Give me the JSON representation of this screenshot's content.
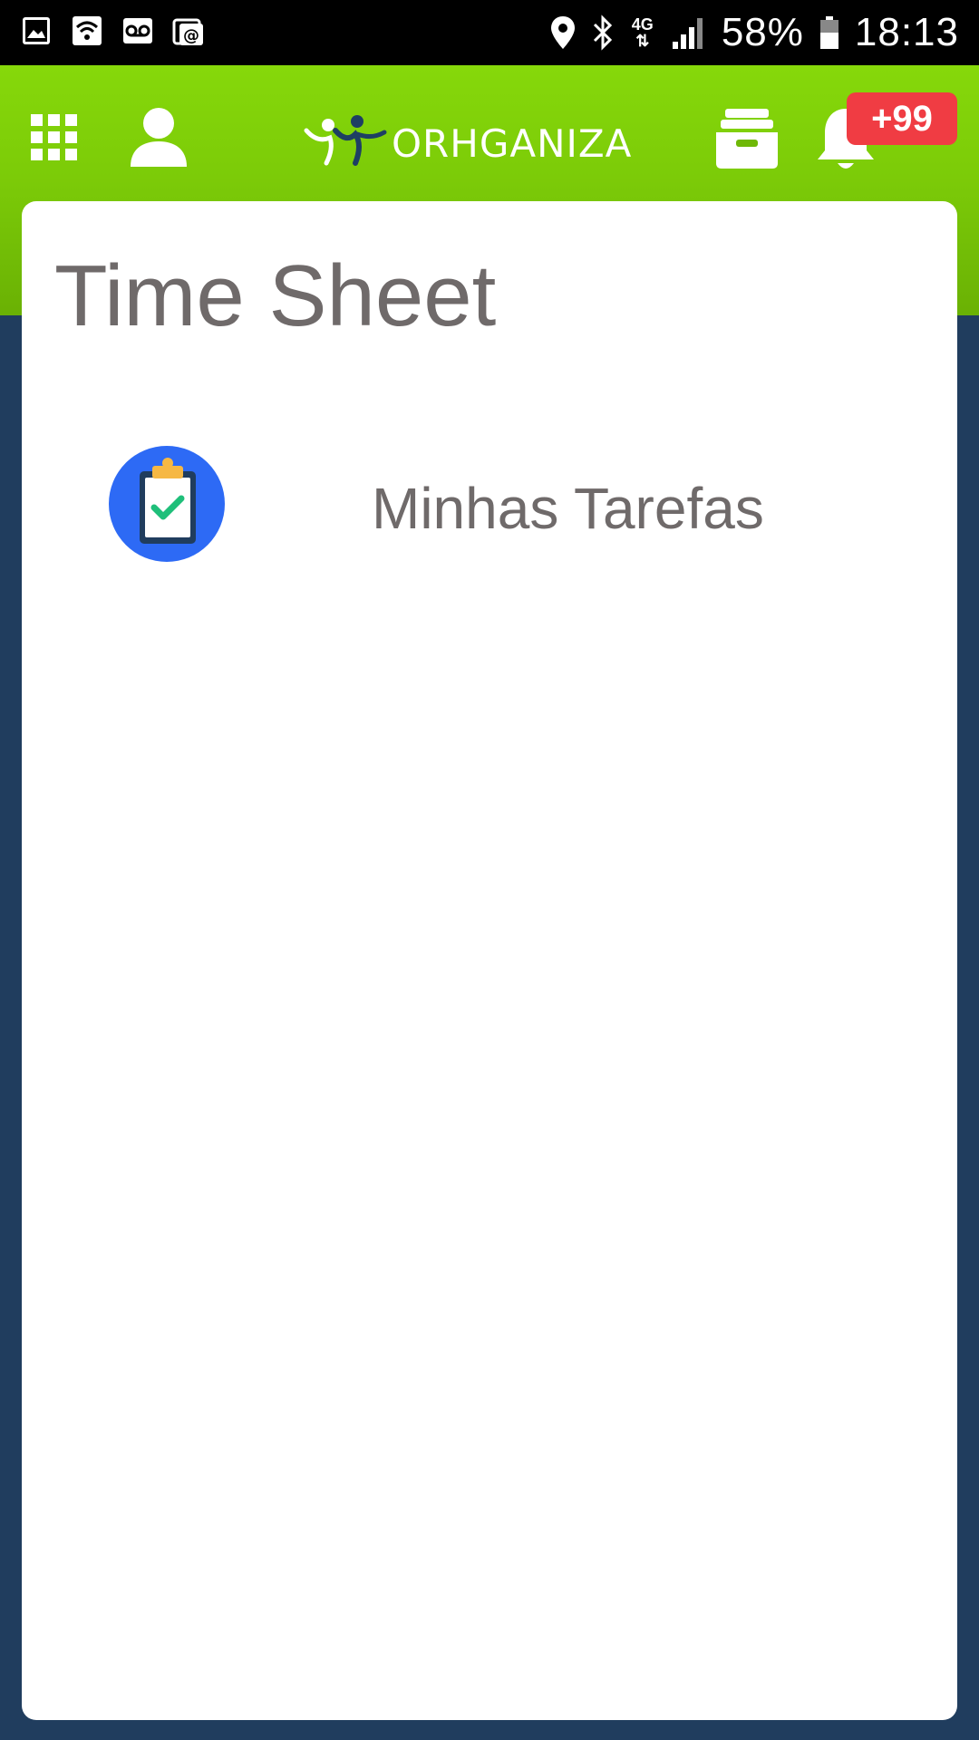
{
  "status_bar": {
    "battery": "58%",
    "time": "18:13",
    "network": "4G"
  },
  "header": {
    "logo_text": "ORHGANIZA",
    "notification_badge": "+99"
  },
  "page": {
    "title": "Time Sheet"
  },
  "items": [
    {
      "label": "Minhas Tarefas",
      "icon": "clipboard-check-icon"
    }
  ],
  "colors": {
    "header_green": "#7ccb08",
    "background_navy": "#203d5e",
    "badge_red": "#f03c43",
    "icon_blue": "#2d6af5",
    "text_gray": "#6f6a6a"
  }
}
